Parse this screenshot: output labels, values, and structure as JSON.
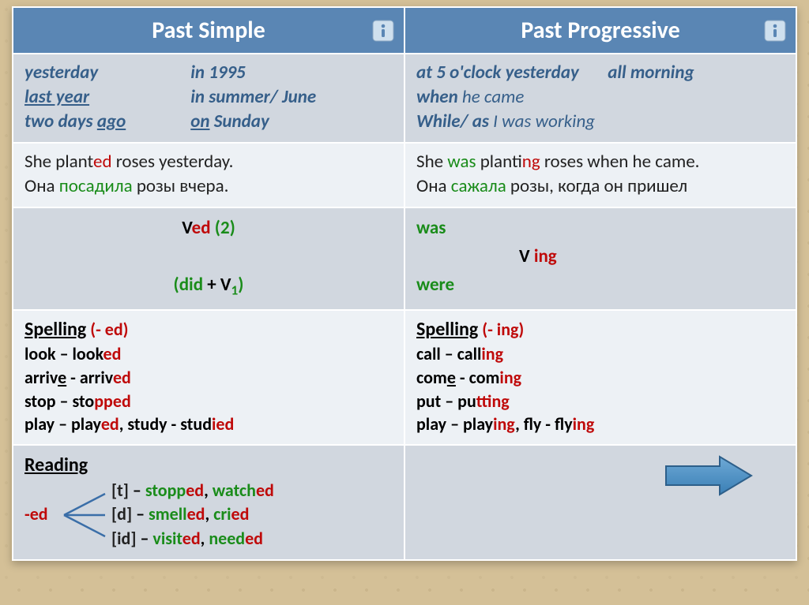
{
  "header": {
    "left": "Past Simple",
    "right": "Past Progressive"
  },
  "signals": {
    "left": {
      "col1": [
        "yesterday",
        "last year",
        "two days ago"
      ],
      "col2": [
        "in 1995",
        "in summer/ June",
        "on Sunday"
      ]
    },
    "right": [
      {
        "pre": "at 5 o'clock  yesterday",
        "post": "all morning"
      },
      {
        "pre": "when ",
        "light": "he came"
      },
      {
        "pre": "While/ as ",
        "light": "I was working"
      }
    ]
  },
  "example": {
    "left": {
      "line1_a": "She  plant",
      "line1_b": "ed",
      "line1_c": " roses yesterday.",
      "line2_a": "Она ",
      "line2_b": "посадила",
      "line2_c": " розы вчера."
    },
    "right": {
      "line1_a": "She ",
      "line1_b": "was",
      "line1_c": " plant",
      "line1_d": "ing",
      "line1_e": " roses when he came.",
      "line2_a": "Она ",
      "line2_b": "сажала",
      "line2_c": " розы, когда он пришел"
    }
  },
  "formula": {
    "left": {
      "v": "V",
      "ed": "ed",
      "two": " (2)",
      "did": "(did",
      "plus": " + V",
      "one": "1",
      "close": ")"
    },
    "right": {
      "was": "was",
      "v": "V ",
      "ing": "ing",
      "were": "were"
    }
  },
  "spelling": {
    "left": {
      "title_a": "Spelling",
      "title_b": "  (- ed)",
      "l1a": "look – look",
      "l1b": "ed",
      "l2a": "arriv",
      "l2u": "e",
      "l2b": " - arriv",
      "l2c": "ed",
      "l3a": "stop – sto",
      "l3b": "pp",
      "l3c": "ed",
      "l4a": "play – play",
      "l4b": "ed",
      "l4c": ", study - stud",
      "l4d": "ied"
    },
    "right": {
      "title_a": "Spelling",
      "title_b": "  (- ing)",
      "l1a": "call – call",
      "l1b": "ing",
      "l2a": "com",
      "l2u": "e",
      "l2b": " - com",
      "l2c": "ing",
      "l3a": "put – pu",
      "l3b": "tt",
      "l3c": "ing",
      "l4a": "play – play",
      "l4b": "ing",
      "l4c": ", fly - fly",
      "l4d": "ing"
    }
  },
  "reading": {
    "title": "Reading",
    "ed": "-ed",
    "r1": {
      "s": "[t]",
      "dash": " – ",
      "w1a": "stopp",
      "w1b": "ed",
      "sep": ", ",
      "w2a": "watch",
      "w2b": "ed"
    },
    "r2": {
      "s": "[d]",
      "dash": " – ",
      "w1a": "smell",
      "w1b": "ed",
      "sep": ", ",
      "w2a": "cri",
      "w2b": "ed"
    },
    "r3": {
      "s": "[id]",
      "dash": " – ",
      "w1a": "visit",
      "w1b": "ed",
      "sep": ", ",
      "w2a": "need",
      "w2b": "ed"
    }
  }
}
